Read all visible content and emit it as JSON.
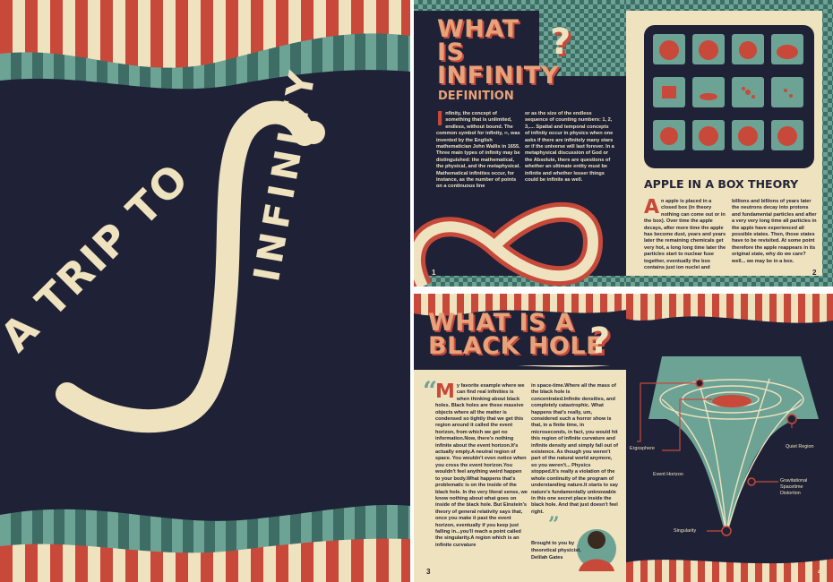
{
  "colors": {
    "navy": "#1f2236",
    "cream": "#efe2bf",
    "red": "#c8493a",
    "teal": "#6ca394",
    "peach": "#e8a27a"
  },
  "cover": {
    "title_part1": "A TRIP TO",
    "title_part2": "INFINITY"
  },
  "page1": {
    "heading": "WHAT IS INFINITY",
    "question_mark": "?",
    "section_title": "DEFINITION",
    "drop_cap": "I",
    "col1": "nfinity, the concept of something that is unlimited, endless, without bound. The common symbol for infinity, ∞, was invented by the English mathematician John Wallis in 1655. Three main types of infinity may be distinguished: the mathematical, the physical, and the metaphysical. Mathematical infinities occur, for instance, as the number of points on a continuous line",
    "col2": "or as the size of the endless sequence of counting numbers: 1, 2, 3,.... Spatial and temporal concepts of infinity occur in physics when one asks if there are infinitely many stars or if the universe will last forever. In a metaphysical discussion of God or the Absolute, there are questions of whether an ultimate entity must be infinite and whether lesser things could be infinite as well.",
    "page_number": "1"
  },
  "page2": {
    "heading": "APPLE IN A BOX THEORY",
    "drop_cap": "A",
    "col1": "n apple is placed in a closed box (in theory nothing can come out or in the box). Over time the apple decays, after more time the apple has become dust, years and years later the remaining chemicals get very hot, a long long time later the particles start to nuclear fuse together, eventually the box contains just ion nuclei and photons, and then",
    "col2": "billions and billions of years later the neutrons decay into protons and fundamental particles and after a very very long time all particles in the apple have experienced all possible states. Then, those states have to be revisited. At some point therefore the apple reappears in its original state, why do we care? well... we may be in a box.",
    "page_number": "2"
  },
  "page3": {
    "heading_line1": "WHAT IS A",
    "heading_line2": "BLACK HOLE",
    "question_mark": "?",
    "open_quote": "“",
    "close_quote": "”",
    "drop_cap": "M",
    "col1": "y favorite example where we can find real infinities is when thinking about black holes. Black holes are these massive objects where all the matter is condensed so tightly that we get this region around it called the event horizon, from which we get no information.Now, there's nothing infinite about the event horizon.It's actually empty.A neutral region of space. You wouldn't even notice when you cross the event horizon.You wouldn't feel anything weird happen to your body.What happens that's problematic is on the inside of the black hole. In the very literal sense, we know nothing about what goes on inside of the black hole. But Einstein's theory of general relativity says that, once you make it past the event horizon, eventually if you keep just falling in...you'll reach a point called the singularity.A region which is an infinite curvature",
    "col2": "in space-time.Where all the mass of the black hole is concentrated.Infinite densities, and completely catastrophic. What happens that's really, um, considered such a horror show is that, in a finite time, in microseconds, in fact, you would hit this region of infinite curvature and infinite density and simply fall out of existence. As though you weren't part of the natural world anymore, so you weren't... Physics stopped.It's really a violation of the whole continuity of the program of understanding nature.It starts to say nature's fundamentally unknowable in this one secret place inside the black hole. And that just doesn't feel right.",
    "credit_line1": "Brought to you by",
    "credit_line2": "theoretical physicist,",
    "credit_line3": "Delilah Gates",
    "page_number": "3"
  },
  "page4": {
    "labels": {
      "ergosphere": "Ergosphere",
      "event_horizon": "Event Horizon",
      "quiet_region": "Quiet Region",
      "distortion_line1": "Gravitational",
      "distortion_line2": "Spacetime",
      "distortion_line3": "Distortion",
      "singularity": "Singularity"
    },
    "page_number": "4"
  }
}
